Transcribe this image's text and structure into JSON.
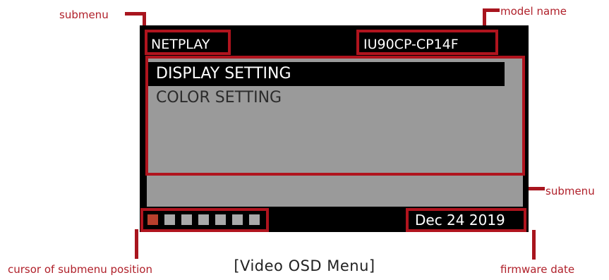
{
  "callouts": {
    "submenu_top": "submenu",
    "model_name": "model name",
    "submenu_right": "submenu",
    "cursor_position": "cursor of submenu position",
    "firmware_date": "firmware date"
  },
  "osd": {
    "title": "NETPLAY",
    "model": "IU90CP-CP14F",
    "menu_items": [
      {
        "label": "DISPLAY SETTING",
        "selected": true
      },
      {
        "label": "COLOR SETTING",
        "selected": false
      }
    ],
    "position_indicator": {
      "total": 7,
      "active_index": 0
    },
    "date": "Dec 24 2019"
  },
  "caption": "[Video OSD Menu]",
  "colors": {
    "accent_red": "#b0141e",
    "label_red": "#b0202a",
    "screen_bg": "#000000",
    "menu_bg": "#9a9a9a",
    "active_square": "#b8402d",
    "inactive_square": "#a9a9a9"
  }
}
